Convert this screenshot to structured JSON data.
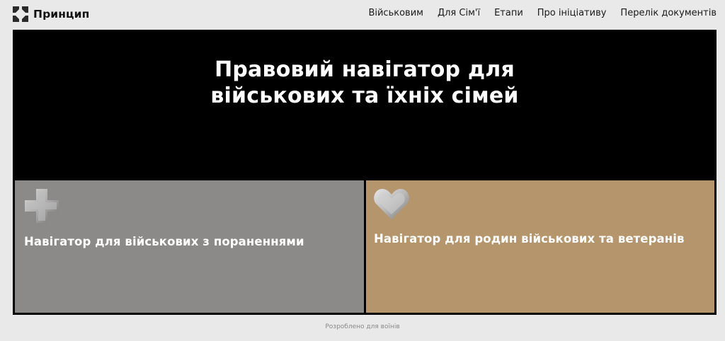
{
  "header": {
    "logo_text": "Принцип",
    "nav": [
      {
        "label": "Військовим"
      },
      {
        "label": "Для Сім'ї"
      },
      {
        "label": "Етапи"
      },
      {
        "label": "Про ініціативу"
      },
      {
        "label": "Перелік документів"
      }
    ]
  },
  "hero": {
    "title_line1": "Правовий навігатор для",
    "title_line2": "військових та їхніх сімей"
  },
  "cards": [
    {
      "label": "Навігатор для військових з пораненнями",
      "icon": "cross-icon",
      "color": "#8c8a89"
    },
    {
      "label": "Навігатор для родин військових та ветеранів",
      "icon": "heart-icon",
      "color": "#b4956c"
    }
  ],
  "footer": {
    "text": "Розроблено для воїнів"
  },
  "colors": {
    "page_background": "#e9e9e9",
    "hero_background": "#000000"
  }
}
